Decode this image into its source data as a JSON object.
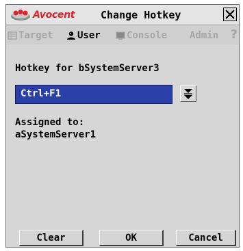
{
  "window": {
    "brand": "Avocent",
    "title": "Change Hotkey"
  },
  "tabs": [
    {
      "label": "Target",
      "icon": "target-icon",
      "active": false
    },
    {
      "label": "User",
      "icon": "user-icon",
      "active": true
    },
    {
      "label": "Console",
      "icon": "console-icon",
      "active": false
    },
    {
      "label": "Admin",
      "icon": "",
      "active": false
    }
  ],
  "help_label": "?",
  "hotkey": {
    "heading": "Hotkey for bSystemServer3",
    "selected": "Ctrl+F1",
    "assigned_label": "Assigned to:",
    "assigned_value": "aSystemServer1"
  },
  "buttons": {
    "clear": "Clear",
    "ok": "OK",
    "cancel": "Cancel"
  },
  "colors": {
    "brand_red": "#d8262d",
    "select_bg": "#2b3fa8",
    "dialog_bg": "#d6d6d6",
    "disabled_text": "#a6a6a6"
  }
}
